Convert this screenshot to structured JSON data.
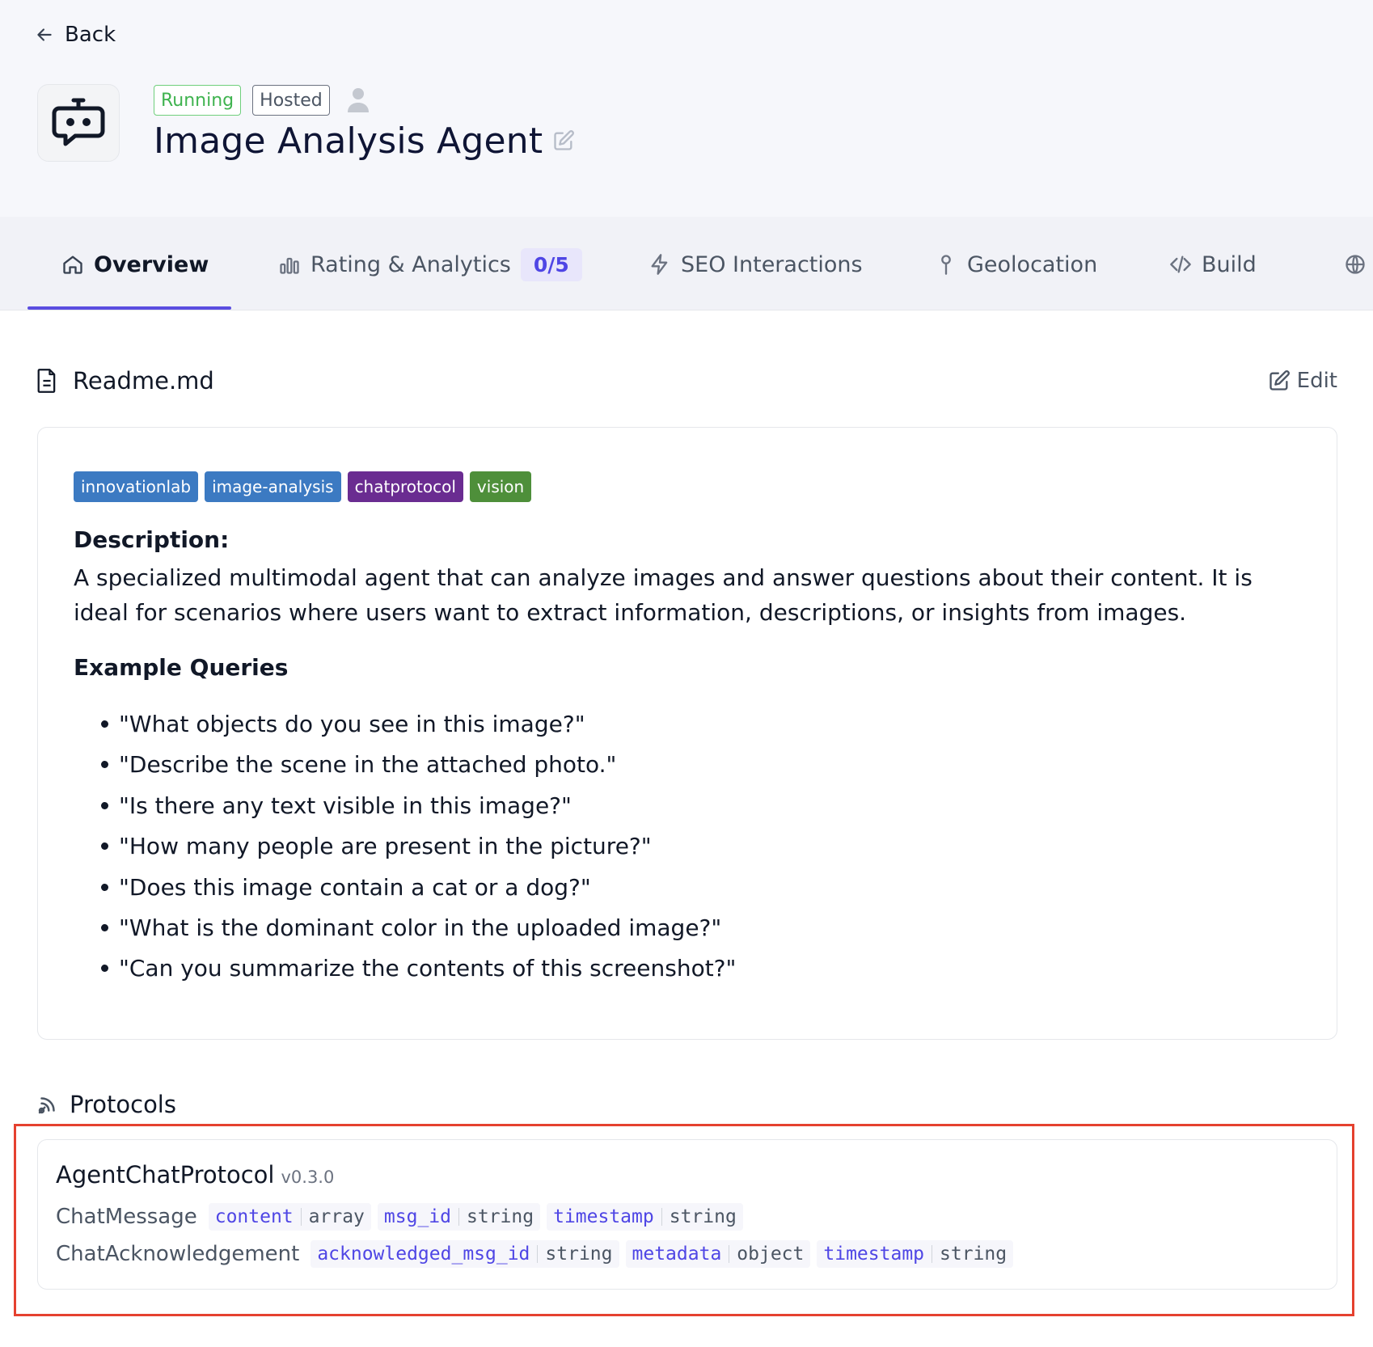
{
  "nav": {
    "back_label": "Back"
  },
  "agent": {
    "status_badge": "Running",
    "hosting_badge": "Hosted",
    "name": "Image Analysis Agent"
  },
  "tabs": [
    {
      "label": "Overview",
      "icon": "home-icon",
      "active": true
    },
    {
      "label": "Rating & Analytics",
      "icon": "bar-chart-icon",
      "count": "0/5"
    },
    {
      "label": "SEO Interactions",
      "icon": "lightning-icon"
    },
    {
      "label": "Geolocation",
      "icon": "pin-icon"
    },
    {
      "label": "Build",
      "icon": "code-icon"
    }
  ],
  "readme": {
    "title": "Readme.md",
    "edit_label": "Edit",
    "tags": [
      {
        "label": "innovationlab",
        "color": "#3c7ac2"
      },
      {
        "label": "image-analysis",
        "color": "#3c7ac2"
      },
      {
        "label": "chatprotocol",
        "color": "#6a2c91"
      },
      {
        "label": "vision",
        "color": "#4e8f3a"
      }
    ],
    "description_label": "Description:",
    "description": "A specialized multimodal agent that can analyze images and answer questions about their content. It is ideal for scenarios where users want to extract information, descriptions, or insights from images.",
    "examples_label": "Example Queries",
    "examples": [
      "\"What objects do you see in this image?\"",
      "\"Describe the scene in the attached photo.\"",
      "\"Is there any text visible in this image?\"",
      "\"How many people are present in the picture?\"",
      "\"Does this image contain a cat or a dog?\"",
      "\"What is the dominant color in the uploaded image?\"",
      "\"Can you summarize the contents of this screenshot?\""
    ]
  },
  "protocols": {
    "title": "Protocols",
    "items": [
      {
        "name": "AgentChatProtocol",
        "version": "v0.3.0",
        "messages": [
          {
            "name": "ChatMessage",
            "fields": [
              {
                "name": "content",
                "type": "array"
              },
              {
                "name": "msg_id",
                "type": "string"
              },
              {
                "name": "timestamp",
                "type": "string"
              }
            ]
          },
          {
            "name": "ChatAcknowledgement",
            "fields": [
              {
                "name": "acknowledged_msg_id",
                "type": "string"
              },
              {
                "name": "metadata",
                "type": "object"
              },
              {
                "name": "timestamp",
                "type": "string"
              }
            ]
          }
        ]
      }
    ]
  },
  "colors": {
    "accent": "#5b4ee0",
    "running": "#3fb34f",
    "highlight": "#e5412f"
  }
}
